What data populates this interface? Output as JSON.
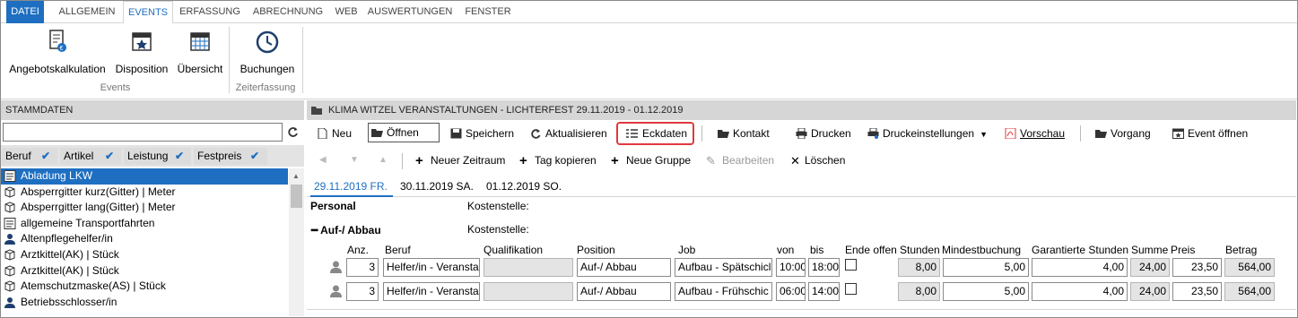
{
  "menu": {
    "tabs": [
      "DATEI",
      "ALLGEMEIN",
      "EVENTS",
      "ERFASSUNG",
      "ABRECHNUNG",
      "WEB",
      "AUSWERTUNGEN",
      "FENSTER"
    ]
  },
  "ribbon": {
    "buttons": [
      "Angebotskalkulation",
      "Disposition",
      "Übersicht",
      "Buchungen"
    ],
    "groups": [
      "Events",
      "Zeiterfassung"
    ]
  },
  "left": {
    "title": "STAMMDATEN",
    "search_value": "",
    "filters": [
      "Beruf",
      "Artikel",
      "Leistung",
      "Festpreis"
    ],
    "items": [
      {
        "label": "Abladung LKW",
        "icon": "doc-icon"
      },
      {
        "label": "Absperrgitter kurz(Gitter) | Meter",
        "icon": "box-icon"
      },
      {
        "label": "Absperrgitter lang(Gitter) | Meter",
        "icon": "box-icon"
      },
      {
        "label": "allgemeine Transportfahrten",
        "icon": "doc-icon"
      },
      {
        "label": "Altenpflegehelfer/in",
        "icon": "person-icon"
      },
      {
        "label": "Arztkittel(AK) | Stück",
        "icon": "box-icon"
      },
      {
        "label": "Arztkittel(AK) | Stück",
        "icon": "box-icon"
      },
      {
        "label": "Atemschutzmaske(AS) | Stück",
        "icon": "box-icon"
      },
      {
        "label": "Betriebsschlosser/in",
        "icon": "person-icon"
      }
    ]
  },
  "right": {
    "title": "KLIMA WITZEL VERANSTALTUNGEN - LICHTERFEST 29.11.2019 - 01.12.2019",
    "toolbar": [
      "Neu",
      "Öffnen",
      "Speichern",
      "Aktualisieren",
      "Eckdaten",
      "Kontakt",
      "Drucken",
      "Druckeinstellungen",
      "Vorschau",
      "Vorgang",
      "Event öffnen"
    ],
    "toolbar2": [
      "Neuer Zeitraum",
      "Tag kopieren",
      "Neue Gruppe",
      "Bearbeiten",
      "Löschen"
    ],
    "days": [
      "29.11.2019 FR.",
      "30.11.2019 SA.",
      "01.12.2019 SO."
    ],
    "section_personal": "Personal",
    "kostenstelle": "Kostenstelle:",
    "group_label": "Auf-/ Abbau",
    "columns": [
      "Anz.",
      "Beruf",
      "Qualifikation",
      "Position",
      "Job",
      "von",
      "bis",
      "Ende offen",
      "Stunden",
      "Mindestbuchung",
      "Garantierte Stunden",
      "Summe",
      "Preis",
      "Betrag"
    ],
    "rows": [
      {
        "anz": "3",
        "beruf": "Helfer/in - Veransta",
        "qual": "",
        "position": "Auf-/ Abbau",
        "job": "Aufbau - Spätschicl",
        "von": "10:00",
        "bis": "18:00",
        "stunden": "8,00",
        "mindest": "5,00",
        "garantiert": "4,00",
        "summe": "24,00",
        "preis": "23,50",
        "betrag": "564,00"
      },
      {
        "anz": "3",
        "beruf": "Helfer/in - Veransta",
        "qual": "",
        "position": "Auf-/ Abbau",
        "job": "Aufbau - Frühschic",
        "von": "06:00",
        "bis": "14:00",
        "stunden": "8,00",
        "mindest": "5,00",
        "garantiert": "4,00",
        "summe": "24,00",
        "preis": "23,50",
        "betrag": "564,00"
      }
    ]
  },
  "colors": {
    "accent": "#1e6fc1",
    "highlight": "#e0393e"
  }
}
